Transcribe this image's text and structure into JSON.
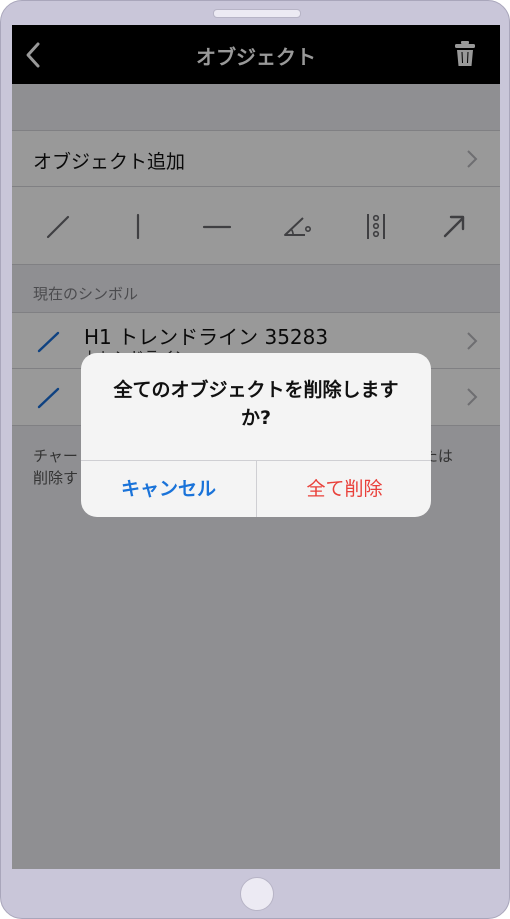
{
  "navbar": {
    "title": "オブジェクト",
    "back_icon": "chevron-left-icon",
    "trash_icon": "trash-icon"
  },
  "add_object": {
    "label": "オブジェクト追加"
  },
  "tools": [
    {
      "icon": "trend-line-icon"
    },
    {
      "icon": "vertical-line-icon"
    },
    {
      "icon": "horizontal-line-icon"
    },
    {
      "icon": "angle-icon"
    },
    {
      "icon": "fibonacci-icon"
    },
    {
      "icon": "arrow-icon"
    }
  ],
  "current_symbols": {
    "section_label": "現在のシンボル",
    "items": [
      {
        "title": "H1 トレンドライン 35283",
        "subtitle": "トレンドライン"
      },
      {
        "title": "",
        "subtitle": ""
      }
    ]
  },
  "footer_note": "チャー　　　　　　　　　　　　　　　　　　　　　　　たは\n削除す",
  "dialog": {
    "message": "全てのオブジェクトを削除しますか?",
    "cancel_label": "キャンセル",
    "delete_label": "全て削除"
  },
  "colors": {
    "accent": "#1a73d9",
    "destructive": "#e9403a",
    "navbar_bg": "#000000",
    "device_frame": "#c9c6d9"
  }
}
